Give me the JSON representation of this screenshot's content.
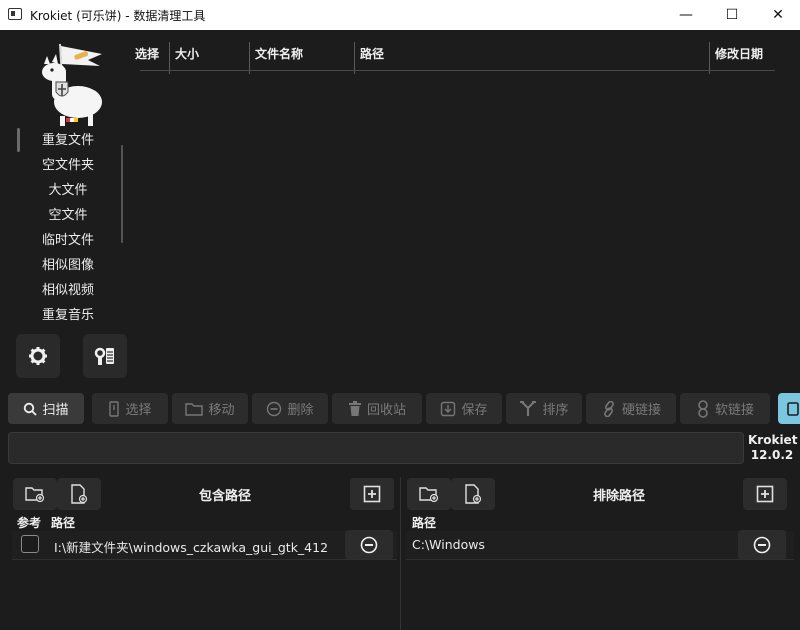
{
  "window": {
    "title": "Krokiet (可乐饼) - 数据清理工具",
    "min_glyph": "—",
    "max_glyph": "☐",
    "close_glyph": "✕"
  },
  "sidebar": {
    "tabs": [
      {
        "label": "重复文件"
      },
      {
        "label": "空文件夹"
      },
      {
        "label": "大文件"
      },
      {
        "label": "空文件"
      },
      {
        "label": "临时文件"
      },
      {
        "label": "相似图像"
      },
      {
        "label": "相似视频"
      },
      {
        "label": "重复音乐"
      }
    ],
    "icons": {
      "settings": "gear-icon",
      "about": "info-icon"
    }
  },
  "results_table": {
    "columns": [
      "选择",
      "大小",
      "文件名称",
      "路径",
      "修改日期"
    ]
  },
  "toolbar": {
    "scan": "扫描",
    "select": "选择",
    "move": "移动",
    "delete": "删除",
    "trash": "回收站",
    "save": "保存",
    "sort": "排序",
    "hardlink": "硬链接",
    "symlink": "软链接"
  },
  "app": {
    "name": "Krokiet",
    "version": "12.0.2"
  },
  "included": {
    "title": "包含路径",
    "col_ref": "参考",
    "col_path": "路径",
    "paths": [
      {
        "path": "I:\\新建文件夹\\windows_czkawka_gui_gtk_412",
        "reference": false
      }
    ]
  },
  "excluded": {
    "title": "排除路径",
    "col_path": "路径",
    "paths": [
      {
        "path": "C:\\Windows"
      }
    ]
  },
  "colors": {
    "accent": "#7cc7e0",
    "background": "#1c1c1c",
    "button": "#2c2c2c"
  }
}
